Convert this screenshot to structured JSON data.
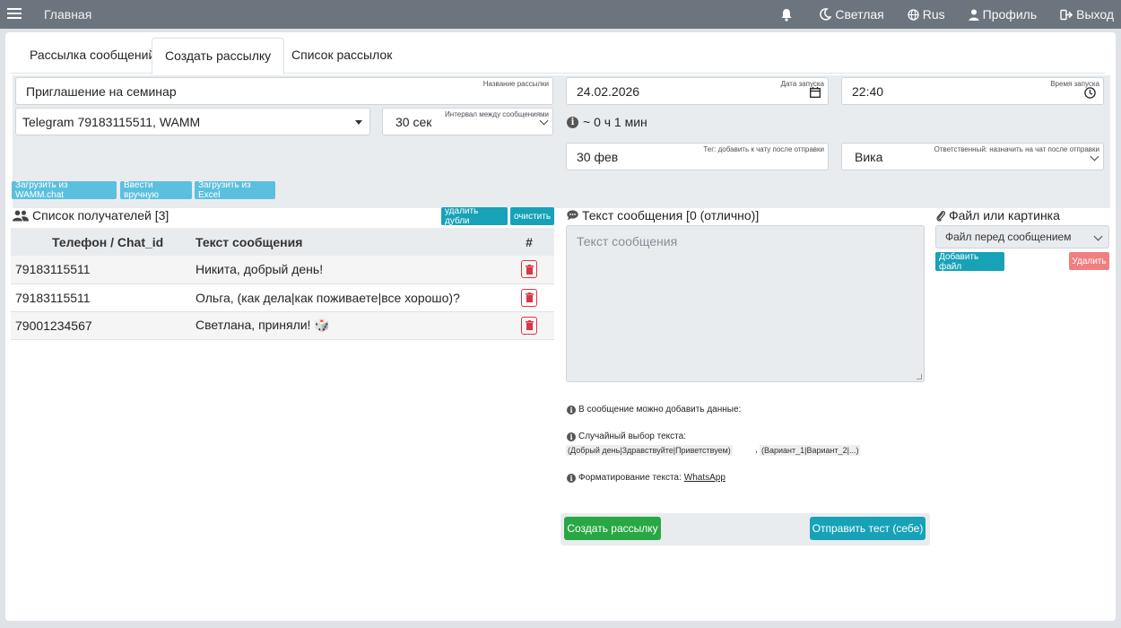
{
  "topbar": {
    "home": "Главная",
    "bell_icon": "bell-icon",
    "theme": "Светлая",
    "lang": "Rus",
    "profile": "Профиль",
    "logout": "Выход"
  },
  "tabs": [
    "Рассылка сообщений",
    "Создать рассылку",
    "Список рассылок"
  ],
  "form": {
    "name_value": "Приглашение на семинар",
    "name_caption": "Название рассылки",
    "date_value": "24.02.2026",
    "date_caption": "Дата запуска",
    "time_value": "22:40",
    "time_caption": "Время запуска",
    "account_value": "Telegram 79183115511, WAMM",
    "interval_value": "30 сек",
    "interval_caption": "Интервал между сообщениями",
    "duration_text": "~ 0 ч 1 мин",
    "tag_value": "30 фев",
    "tag_caption": "Тег: добавить к чату после отправки",
    "responsible_value": "Вика",
    "responsible_caption": "Ответственный: назначить на чат после отправки"
  },
  "loaders": {
    "from_wamm": "Загрузить из WAMM.chat",
    "manual": "Ввести вручную",
    "from_excel": "Загрузить из Excel"
  },
  "recipients": {
    "title": "Список получателей [3]",
    "dedupe": "удалить дубли",
    "clear": "очистить",
    "headers": [
      "Телефон / Chat_id",
      "Текст сообщения",
      "#"
    ],
    "rows": [
      {
        "phone": "79183115511",
        "text": "Никита, добрый день!"
      },
      {
        "phone": "79183115511",
        "text": "Ольга, (как дела|как поживаете|все хорошо)?"
      },
      {
        "phone": "79001234567",
        "text": "Светлана, приняли! 🎲"
      }
    ]
  },
  "message": {
    "title": "Текст сообщения [0 (отлично)]",
    "placeholder": "Текст сообщения",
    "info_data": "В сообщение можно добавить данные:",
    "info_random": "Случайный выбор текста:",
    "example_1": "(Добрый день|Здравствуйте|Приветствуем)",
    "example_sep": ",",
    "example_2": "(Вариант_1|Вариант_2|...)",
    "info_format": "Форматирование текста:",
    "format_link": "WhatsApp"
  },
  "file": {
    "title": "Файл или картинка",
    "select_value": "Файл перед сообщением",
    "add": "Добавить файл",
    "delete": "Удалить"
  },
  "actions": {
    "create": "Создать рассылку",
    "test": "Отправить тест (себе)"
  },
  "colors": {
    "topbar": "#6c757d",
    "primary_green": "#28a745",
    "teal": "#17a2b8",
    "danger": "#dc3545",
    "danger_light": "#f08080"
  }
}
